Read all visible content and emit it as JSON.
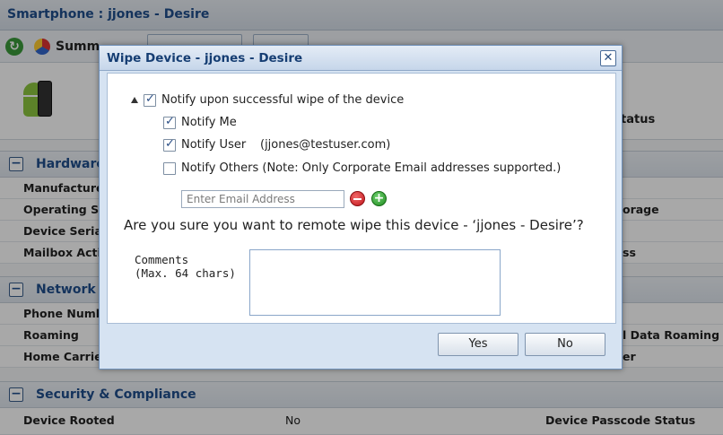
{
  "background": {
    "window_title": "Smartphone : jjones - Desire",
    "toolbar_summary": "Summ",
    "device_partial_status": "tatus",
    "hardware": {
      "section_label": "Hardware",
      "rows": [
        "Manufacture",
        "Operating Sy",
        "Device Seria",
        "Mailbox Acti"
      ],
      "right": [
        "orage",
        "ss"
      ]
    },
    "network": {
      "section_label": "Network",
      "rows": [
        "Phone Numb",
        "Roaming",
        "Home Carrie"
      ],
      "right": [
        "l Data Roaming",
        "er"
      ]
    },
    "security": {
      "section_label": "Security & Compliance",
      "row_key": "Device Rooted",
      "row_value": "No",
      "row_key2": "Device Passcode Status"
    }
  },
  "dialog": {
    "title": "Wipe Device - jjones - Desire",
    "close_glyph": "✕",
    "notify_success_label": "Notify upon successful wipe of the device",
    "notify_me_label": "Notify Me",
    "notify_user_label": "Notify User",
    "notify_user_email": "(jjones@testuser.com)",
    "notify_others_label": "Notify Others (Note: Only Corporate Email addresses supported.)",
    "email_placeholder": "Enter Email Address",
    "question": "Are you sure you want to remote wipe this device - ‘jjones - Desire’?",
    "comments_label_line1": "Comments",
    "comments_label_line2": "(Max. 64 chars)",
    "yes_label": "Yes",
    "no_label": "No",
    "add_glyph": "+"
  }
}
